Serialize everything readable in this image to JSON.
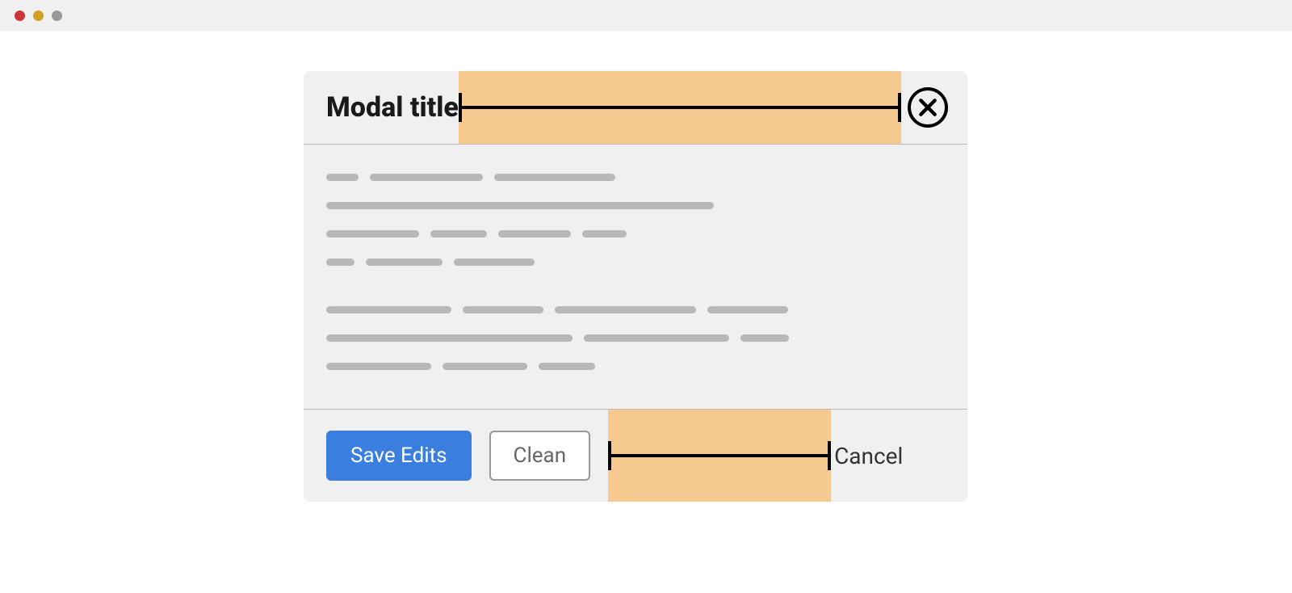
{
  "modal": {
    "title": "Modal title",
    "footer": {
      "save_label": "Save Edits",
      "clean_label": "Clean",
      "cancel_label": "Cancel"
    }
  },
  "colors": {
    "highlight": "#f5c98f",
    "primary": "#3a7ee0"
  }
}
